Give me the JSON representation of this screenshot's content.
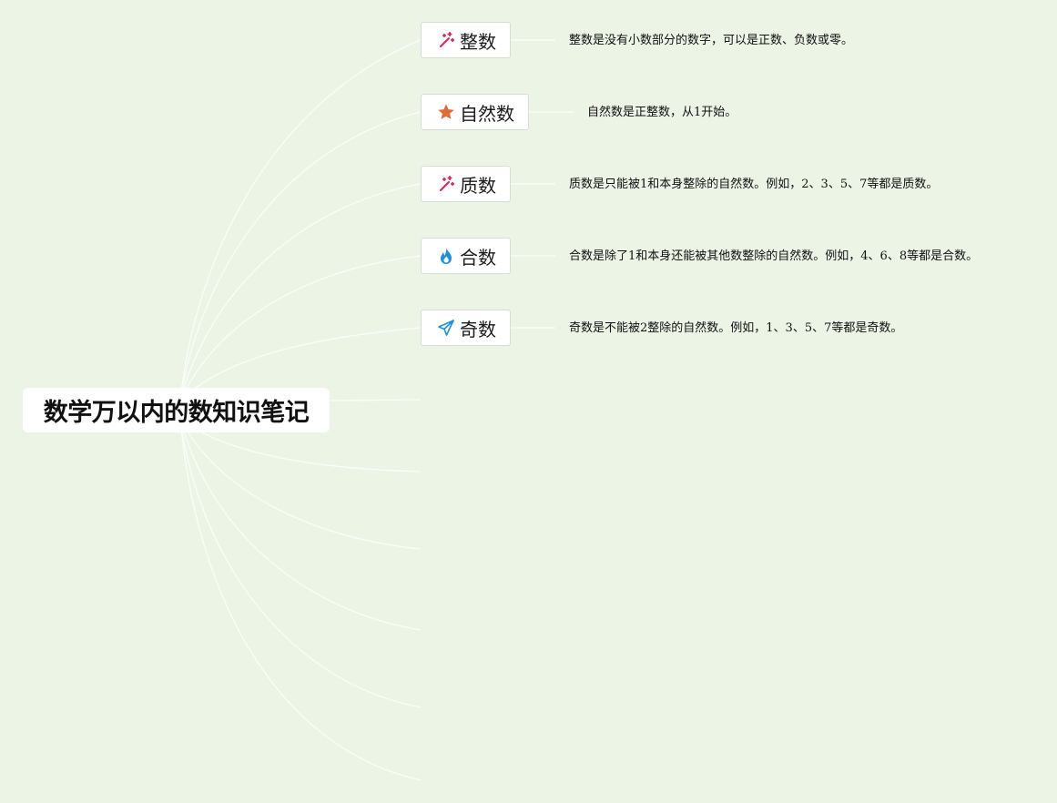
{
  "root": {
    "title": "数学万以内的数知识笔记"
  },
  "topics": [
    {
      "label": "整数",
      "icon": "magic-wand-icon",
      "icon_color": "#e0245e",
      "note": "整数是没有小数部分的数字，可以是正数、负数或零。"
    },
    {
      "label": "自然数",
      "icon": "star-icon",
      "icon_color": "#e06a36",
      "note": "自然数是正整数，从1开始。"
    },
    {
      "label": "质数",
      "icon": "magic-wand-icon",
      "icon_color": "#e0245e",
      "note": "质数是只能被1和本身整除的自然数。例如，2、3、5、7等都是质数。"
    },
    {
      "label": "合数",
      "icon": "fire-icon",
      "icon_color": "#1d8fe0",
      "note": "合数是除了1和本身还能被其他数整除的自然数。例如，4、6、8等都是合数。"
    },
    {
      "label": "奇数",
      "icon": "paper-plane-icon",
      "icon_color": "#1d8fe0",
      "note": "奇数是不能被2整除的自然数。例如，1、3、5、7等都是奇数。"
    }
  ],
  "colors": {
    "background": "#ecf4e6",
    "connector": "#ffffff",
    "node_border": "#d6ddd2"
  }
}
